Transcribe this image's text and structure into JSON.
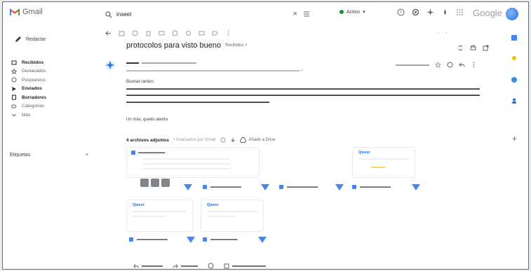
{
  "app": {
    "logo_text": "Gmail",
    "google_word": "Google"
  },
  "search": {
    "query": "inseet",
    "placeholder": ""
  },
  "status": {
    "label": "Activo"
  },
  "colors": {
    "accent": "#1a73e8",
    "active_dot": "#1e8e3e",
    "flag": "#4a86e8",
    "yellow": "#f9d46b"
  },
  "compose": {
    "label": "Redactar"
  },
  "nav": [
    {
      "label": "Recibidos",
      "icon": "inbox-icon",
      "active": true,
      "count": ""
    },
    {
      "label": "Destacados",
      "icon": "star-icon",
      "active": false,
      "count": ""
    },
    {
      "label": "Pospuestos",
      "icon": "clock-icon",
      "active": false,
      "count": ""
    },
    {
      "label": "Enviados",
      "icon": "send-icon",
      "active": true,
      "count": ""
    },
    {
      "label": "Borradores",
      "icon": "draft-icon",
      "active": true,
      "count": ""
    },
    {
      "label": "Categorías",
      "icon": "label-icon",
      "active": false,
      "count": ""
    },
    {
      "label": "Más",
      "icon": "chevron-down-icon",
      "active": false,
      "count": ""
    }
  ],
  "labels_heading": "Etiquetas",
  "email": {
    "subject": "protocolos para visto bueno",
    "subject_tag": "Recibidos",
    "body_greeting": "Buenas tardes:",
    "reply_ref": "Un más, quedo atento"
  },
  "attachments": {
    "count_label": "4 archivos adjuntos",
    "scan_label": "Analizados por Gmail",
    "drive_label": "Añadir a Drive",
    "card_brand": "Qweer"
  }
}
